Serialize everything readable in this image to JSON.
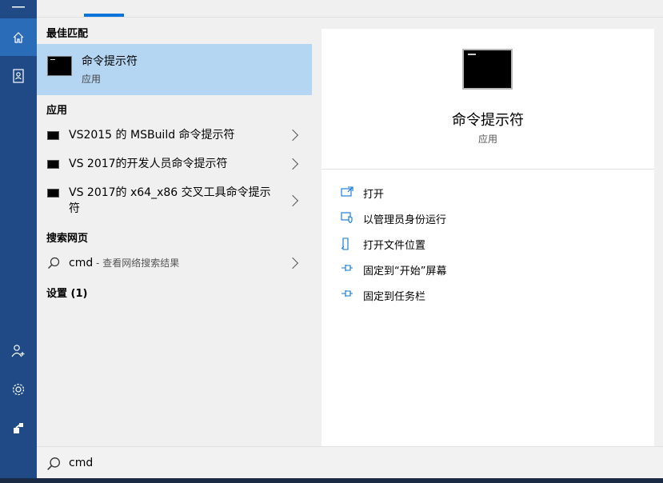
{
  "rail": {
    "icons": [
      "home-icon",
      "notebook-icon",
      "user-add-icon",
      "gear-icon",
      "feedback-icon"
    ]
  },
  "results": {
    "best_match_header": "最佳匹配",
    "best_match": {
      "title": "命令提示符",
      "subtitle": "应用"
    },
    "apps_header": "应用",
    "apps": [
      {
        "label": "VS2015 的 MSBuild 命令提示符"
      },
      {
        "label": "VS 2017的开发人员命令提示符"
      },
      {
        "label": "VS 2017的 x64_x86 交叉工具命令提示符"
      }
    ],
    "web_header": "搜索网页",
    "web": {
      "query": "cmd",
      "hint": " - 查看网络搜索结果"
    },
    "settings_header": "设置 (1)"
  },
  "detail": {
    "title": "命令提示符",
    "subtitle": "应用",
    "actions": [
      {
        "label": "打开",
        "icon": "open-icon"
      },
      {
        "label": "以管理员身份运行",
        "icon": "shield-run-icon"
      },
      {
        "label": "打开文件位置",
        "icon": "file-location-icon"
      },
      {
        "label": "固定到“开始”屏幕",
        "icon": "pin-icon"
      },
      {
        "label": "固定到任务栏",
        "icon": "pin-icon"
      }
    ]
  },
  "search": {
    "value": "cmd"
  },
  "colors": {
    "accent": "#0a74da",
    "rail": "#1f4a86",
    "selected": "#b4d6f2"
  }
}
